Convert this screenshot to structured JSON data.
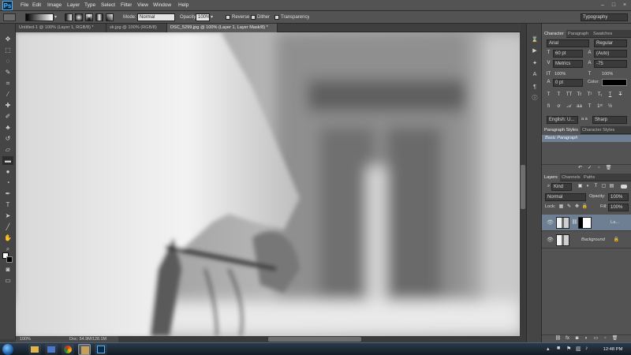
{
  "app": {
    "logo": "Ps"
  },
  "menu": [
    "File",
    "Edit",
    "Image",
    "Layer",
    "Type",
    "Select",
    "Filter",
    "View",
    "Window",
    "Help"
  ],
  "options": {
    "mode_label": "Mode:",
    "mode_value": "Normal",
    "opacity_label": "Opacity:",
    "opacity_value": "100%",
    "reverse_label": "Reverse",
    "dither_label": "Dither",
    "transparency_label": "Transparency",
    "workspace": "Typography"
  },
  "tabs": [
    {
      "label": "Untitled-1 @ 100% (Layer 1, RGB/8) *",
      "active": false
    },
    {
      "label": "sk.jpg @ 100% (RGB/8)",
      "active": false
    },
    {
      "label": "DSC_5299.jpg @ 100% (Layer 1, Layer Mask/8) *",
      "active": true
    }
  ],
  "status": {
    "zoom": "100%",
    "doc": "Doc: 54.9M/128.1M"
  },
  "character_panel": {
    "tabs": [
      "Character",
      "Paragraph",
      "Swatches"
    ],
    "font_family": "Arial",
    "font_style": "Regular",
    "font_size": "60 pt",
    "leading": "(Auto)",
    "kerning": "Metrics",
    "tracking": "-75",
    "vertical_scale": "100%",
    "horizontal_scale": "100%",
    "baseline_shift": "0 pt",
    "color_label": "Color:",
    "color_value": "#000000",
    "language": "English: U...",
    "aa_label": "a a",
    "antialias": "Sharp",
    "style_buttons": [
      "T",
      "T",
      "TT",
      "Tr",
      "T¹",
      "T₁",
      "T",
      "T"
    ]
  },
  "paragraph_styles_panel": {
    "tabs": [
      "Paragraph Styles",
      "Character Styles"
    ],
    "item": "Basic Paragraph"
  },
  "layers_panel": {
    "tabs": [
      "Layers",
      "Channels",
      "Paths"
    ],
    "filter_kind": "Kind",
    "blend_mode": "Normal",
    "opacity_label": "Opacity:",
    "opacity_value": "100%",
    "lock_label": "Lock:",
    "fill_label": "Fill:",
    "fill_value": "100%",
    "layers": [
      {
        "name": "La...",
        "selected": true
      },
      {
        "name": "Background",
        "selected": false
      }
    ]
  },
  "taskbar": {
    "time": "12:48 PM"
  },
  "colors": {
    "accent": "#6e7f94",
    "ui_bg": "#535353",
    "panel_dark": "#3d3d3d"
  }
}
